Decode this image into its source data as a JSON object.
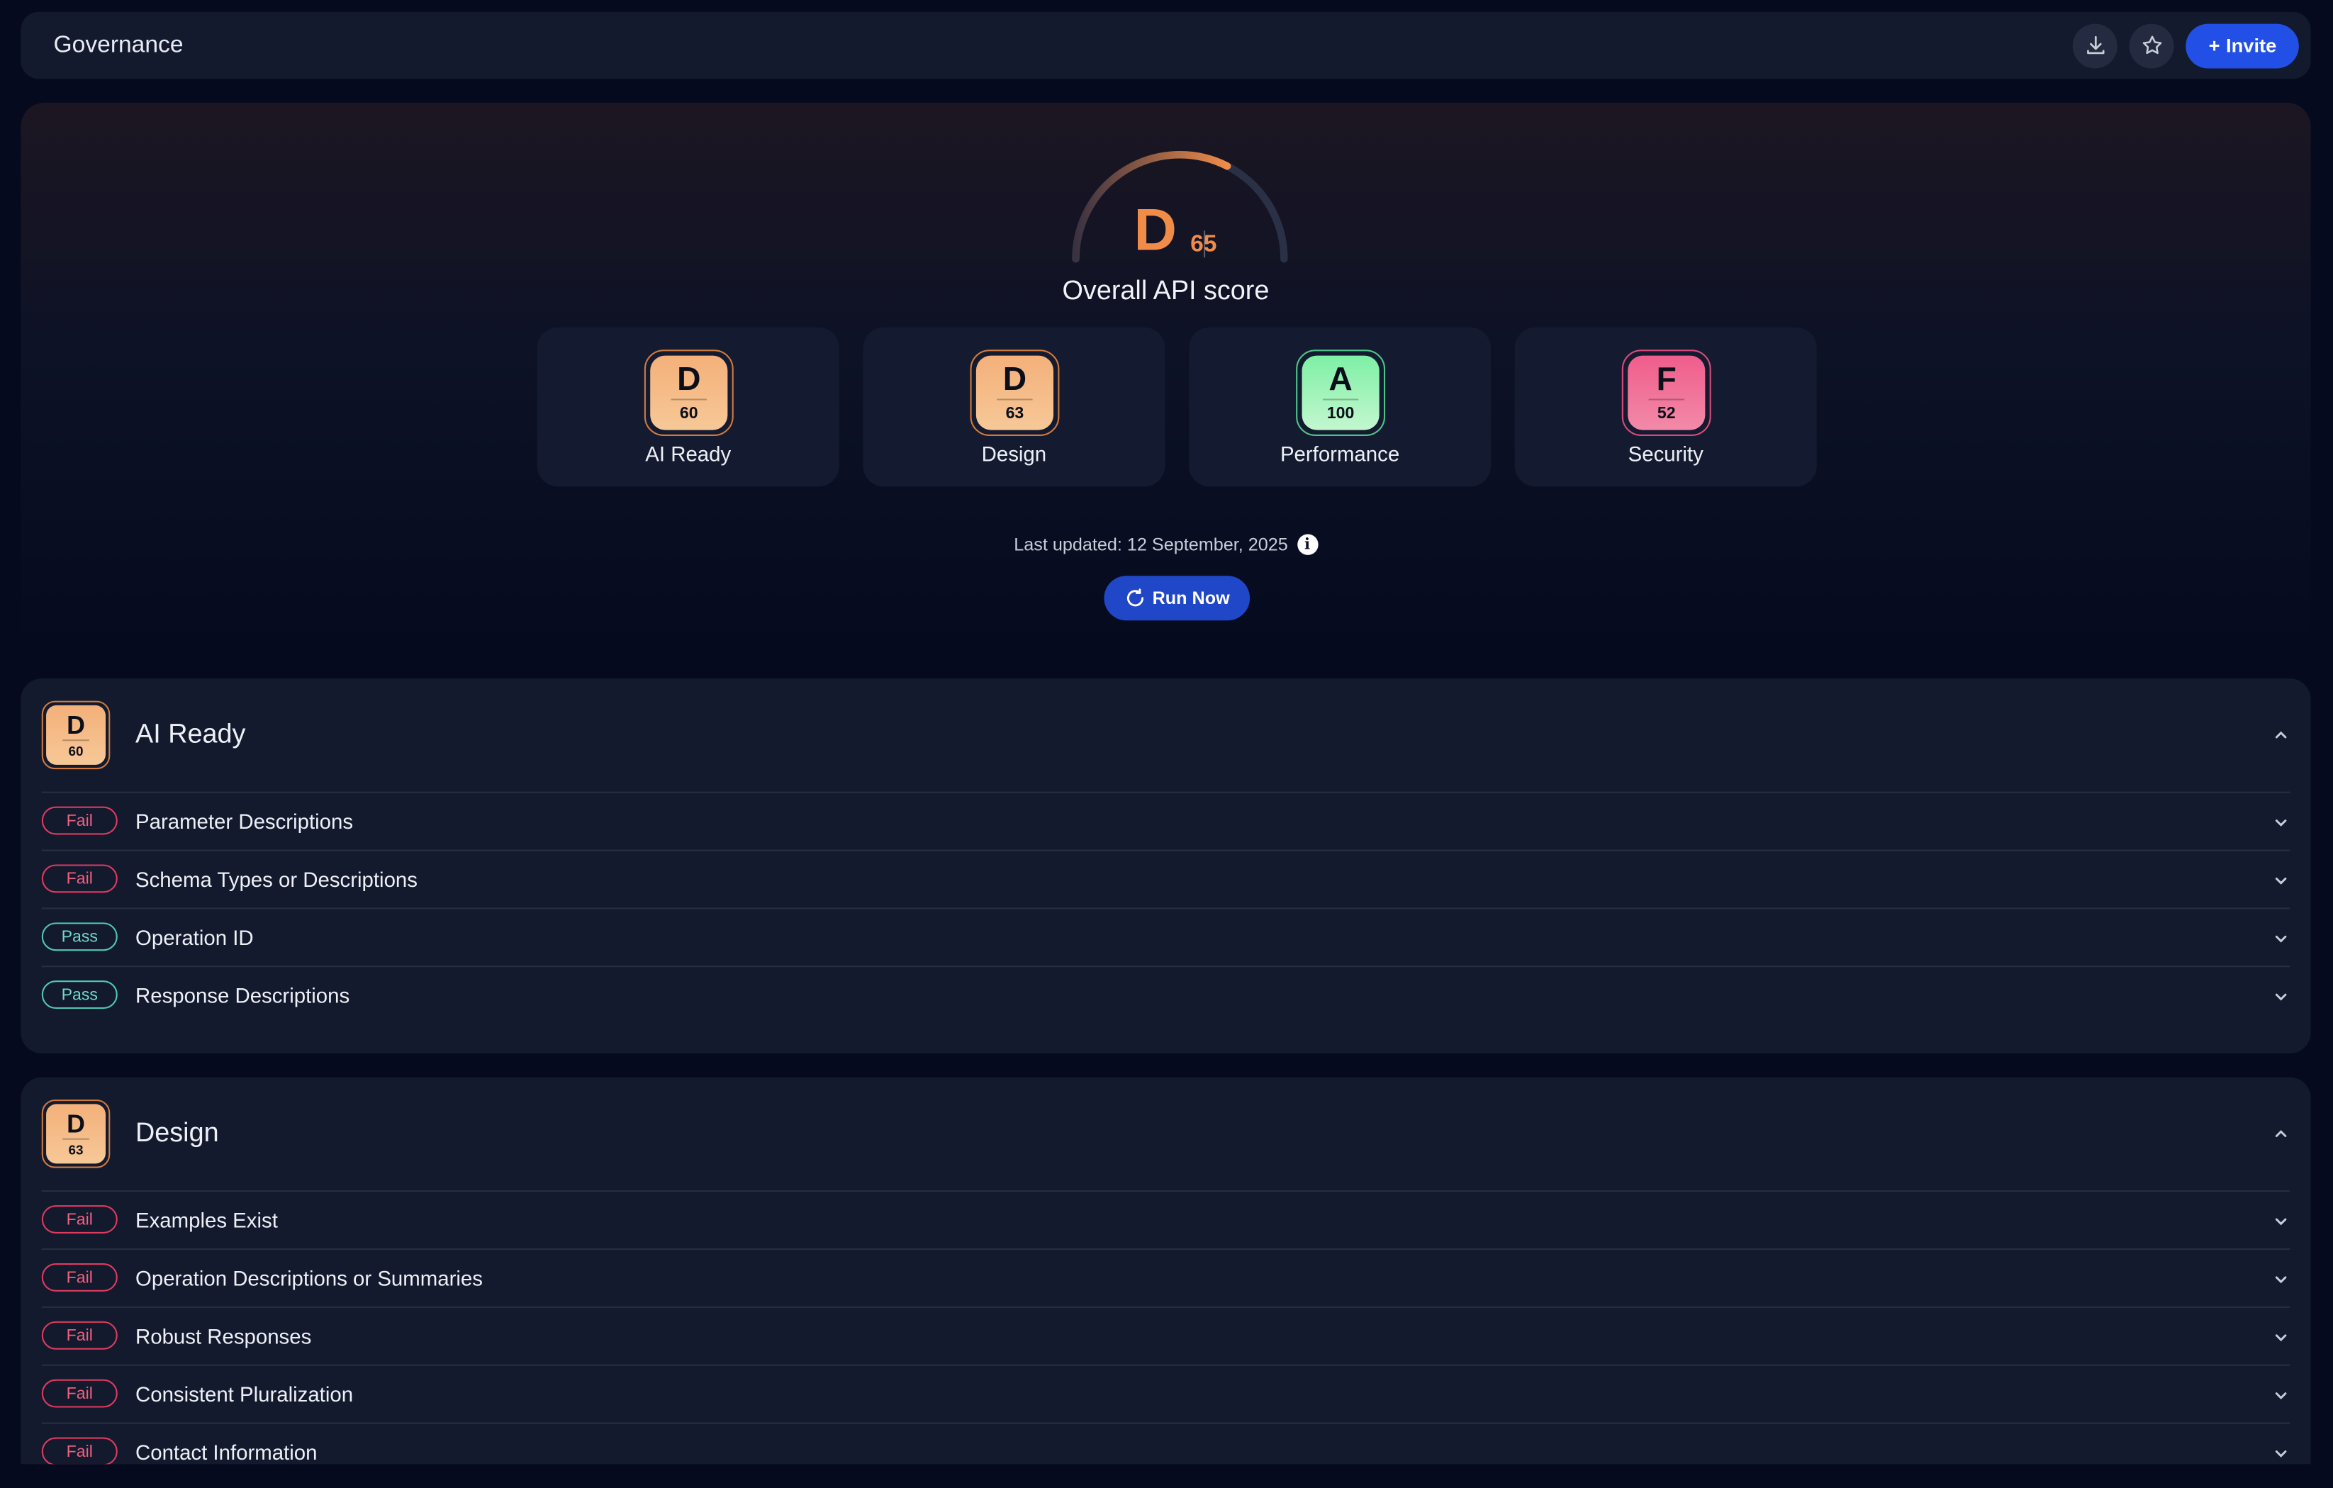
{
  "header": {
    "title": "Governance",
    "invite_label": "Invite"
  },
  "overall": {
    "grade": "D",
    "score": "65",
    "label": "Overall API score",
    "progress": 0.65
  },
  "categories": [
    {
      "name": "AI Ready",
      "grade": "D",
      "score": "60",
      "color": "orange"
    },
    {
      "name": "Design",
      "grade": "D",
      "score": "63",
      "color": "orange"
    },
    {
      "name": "Performance",
      "grade": "A",
      "score": "100",
      "color": "green"
    },
    {
      "name": "Security",
      "grade": "F",
      "score": "52",
      "color": "pink"
    }
  ],
  "last_updated": "Last updated: 12 September, 2025",
  "run_now_label": "Run Now",
  "sections": [
    {
      "title": "AI Ready",
      "grade": "D",
      "score": "60",
      "rules": [
        {
          "status": "Fail",
          "name": "Parameter Descriptions"
        },
        {
          "status": "Fail",
          "name": "Schema Types or Descriptions"
        },
        {
          "status": "Pass",
          "name": "Operation ID"
        },
        {
          "status": "Pass",
          "name": "Response Descriptions"
        }
      ]
    },
    {
      "title": "Design",
      "grade": "D",
      "score": "63",
      "rules": [
        {
          "status": "Fail",
          "name": "Examples Exist"
        },
        {
          "status": "Fail",
          "name": "Operation Descriptions or Summaries"
        },
        {
          "status": "Fail",
          "name": "Robust Responses"
        },
        {
          "status": "Fail",
          "name": "Consistent Pluralization"
        },
        {
          "status": "Fail",
          "name": "Contact Information"
        }
      ]
    }
  ],
  "colors": {
    "accent": "#2250e6",
    "orange": "#f08c48",
    "fail": "#e03a5f",
    "pass": "#4fc9b5"
  }
}
